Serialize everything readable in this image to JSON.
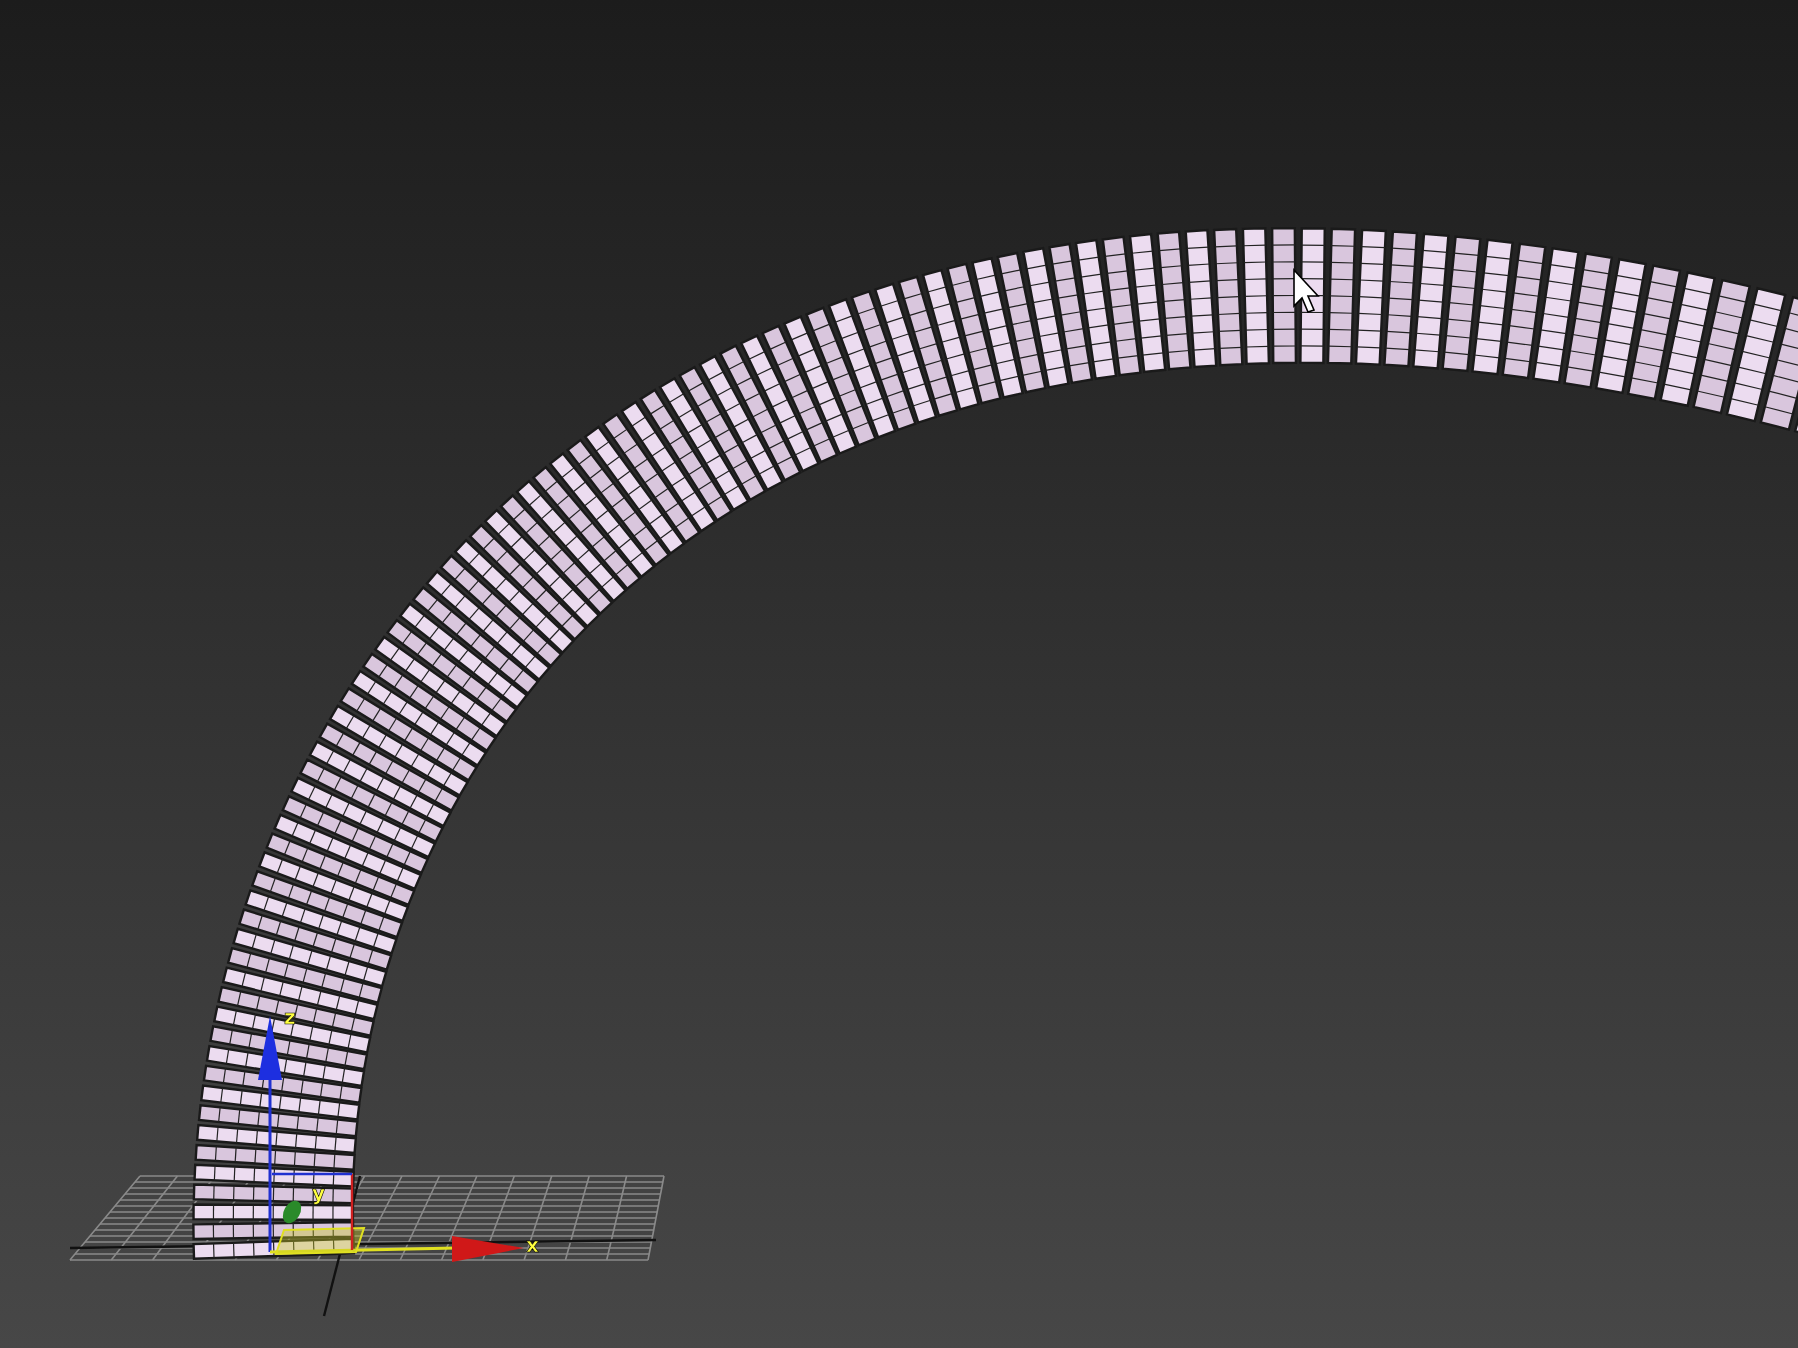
{
  "viewport": {
    "gizmo": {
      "axis_labels": [
        "x",
        "y",
        "z"
      ]
    }
  }
}
